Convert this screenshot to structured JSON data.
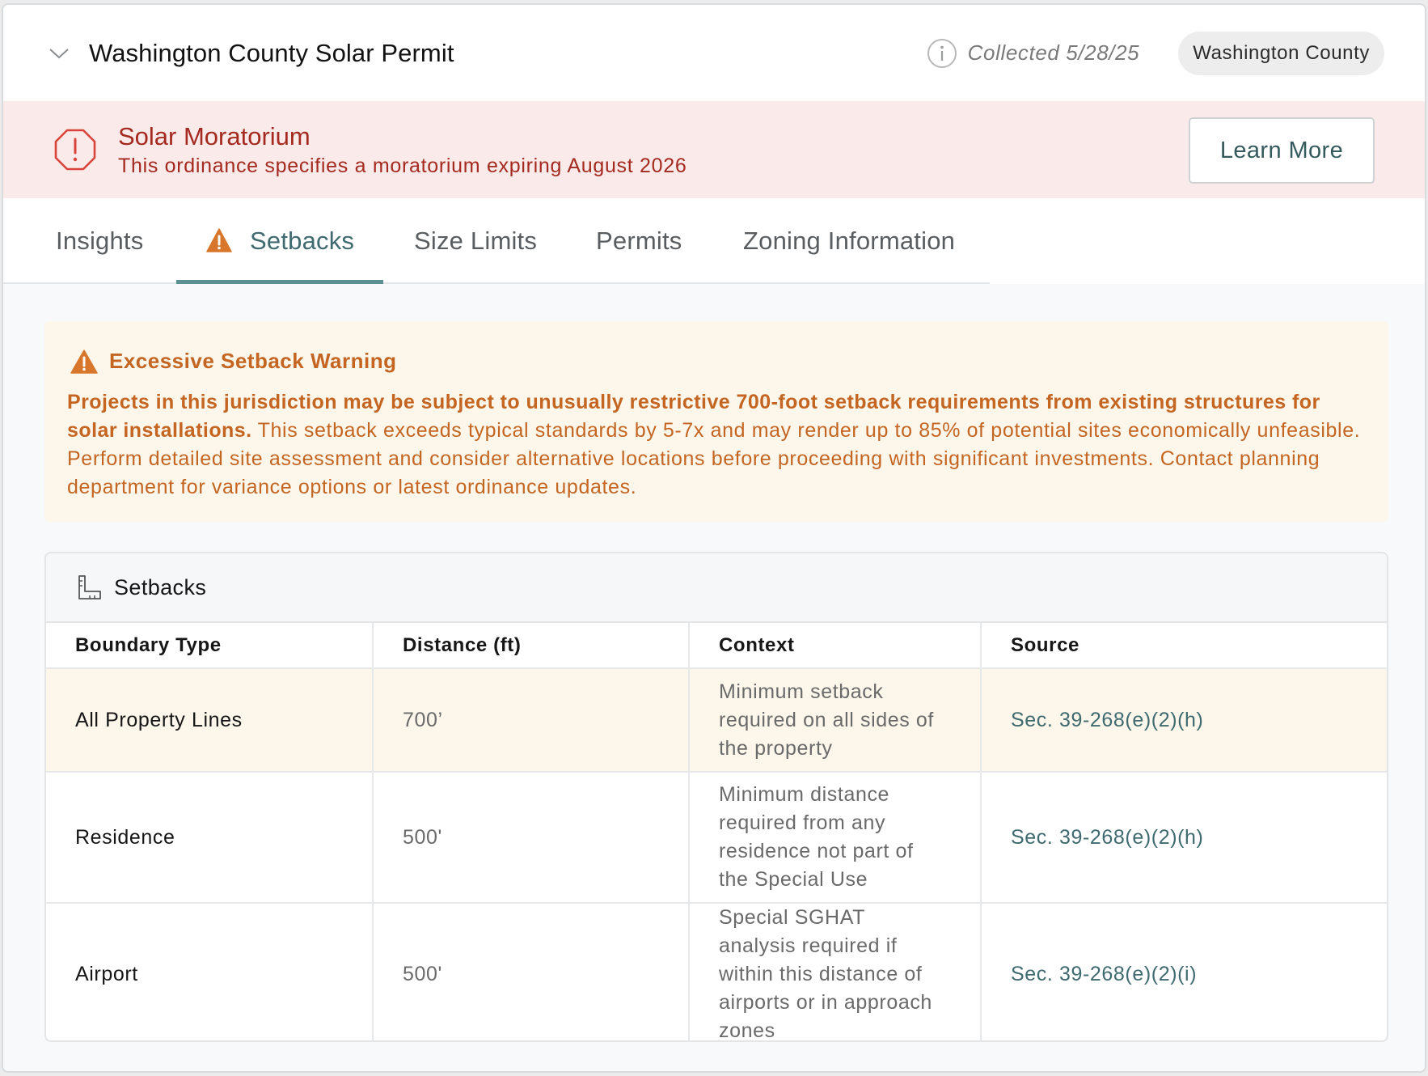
{
  "header": {
    "title": "Washington County Solar Permit",
    "collected": "Collected 5/28/25",
    "county_badge": "Washington County"
  },
  "moratorium": {
    "title": "Solar Moratorium",
    "message": "This ordinance specifies a moratorium expiring August 2026",
    "button_label": "Learn More"
  },
  "tabs": [
    {
      "label": "Insights",
      "active": false
    },
    {
      "label": "Setbacks",
      "active": true,
      "icon": "warning-icon"
    },
    {
      "label": "Size Limits",
      "active": false
    },
    {
      "label": "Permits",
      "active": false
    },
    {
      "label": "Zoning Information",
      "active": false
    }
  ],
  "warning": {
    "title": "Excessive Setback Warning",
    "bold_text": "Projects in this jurisdiction may be subject to unusually restrictive 700-foot setback requirements from existing structures for solar installations.",
    "body_text": " This setback exceeds typical standards by 5-7x and may render up to 85% of potential sites economically unfeasible. Perform detailed site assessment and consider alternative locations before proceeding with significant investments. Contact planning department for variance options or latest ordinance updates."
  },
  "setbacks": {
    "title": "Setbacks",
    "icon": "ruler-icon",
    "columns": [
      "Boundary Type",
      "Distance (ft)",
      "Context",
      "Source"
    ],
    "rows": [
      {
        "type": "All Property Lines",
        "distance": "700’",
        "context": "Minimum setback required on all sides of the property",
        "source": "Sec. 39-268(e)(2)(h)",
        "highlighted": true
      },
      {
        "type": "Residence",
        "distance": "500'",
        "context": "Minimum distance required from any residence not part of the Special Use",
        "source": "Sec. 39-268(e)(2)(h)",
        "highlighted": false
      },
      {
        "type": "Airport",
        "distance": "500'",
        "context": "Special SGHAT analysis required if within this distance of airports or in approach zones",
        "source": "Sec. 39-268(e)(2)(i)",
        "highlighted": false
      }
    ]
  },
  "colors": {
    "danger": "#a42a1f",
    "danger_bg": "#fbeaea",
    "warning": "#c46522",
    "warning_bg": "#fcf7ea",
    "accent": "#3e6a70"
  }
}
